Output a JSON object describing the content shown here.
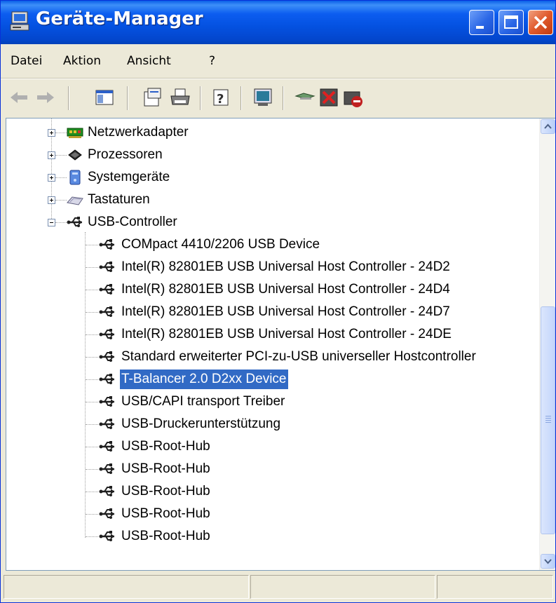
{
  "window": {
    "title": "Geräte-Manager",
    "icon": "device-manager-computer-icon",
    "controls": [
      "minimize-icon",
      "maximize-icon",
      "close-icon"
    ]
  },
  "menu": {
    "items": [
      {
        "label": "Datei"
      },
      {
        "label": "Aktion"
      },
      {
        "label": "Ansicht"
      },
      {
        "label": "?"
      }
    ]
  },
  "toolbar": {
    "buttons": [
      "back-arrow-icon",
      "forward-arrow-icon",
      "show-hide-console-tree-icon",
      "properties-icon",
      "print-icon",
      "help-icon",
      "computer-view-icon",
      "scan-hardware-icon",
      "uninstall-icon",
      "disable-device-icon"
    ]
  },
  "tree": {
    "categories": [
      {
        "label": "Netzwerkadapter",
        "icon": "network-card-icon",
        "expanded": false
      },
      {
        "label": "Prozessoren",
        "icon": "processor-icon",
        "expanded": false
      },
      {
        "label": "Systemgeräte",
        "icon": "system-devices-icon",
        "expanded": false
      },
      {
        "label": "Tastaturen",
        "icon": "keyboard-icon",
        "expanded": false
      },
      {
        "label": "USB-Controller",
        "icon": "usb-icon",
        "expanded": true
      }
    ],
    "usb_devices": [
      {
        "label": "COMpact 4410/2206 USB Device"
      },
      {
        "label": "Intel(R) 82801EB USB Universal Host Controller - 24D2"
      },
      {
        "label": "Intel(R) 82801EB USB Universal Host Controller - 24D4"
      },
      {
        "label": "Intel(R) 82801EB USB Universal Host Controller - 24D7"
      },
      {
        "label": "Intel(R) 82801EB USB Universal Host Controller - 24DE"
      },
      {
        "label": "Standard erweiterter PCI-zu-USB universeller Hostcontroller"
      },
      {
        "label": "T-Balancer 2.0 D2xx Device",
        "selected": true
      },
      {
        "label": "USB/CAPI transport Treiber"
      },
      {
        "label": "USB-Druckerunterstützung"
      },
      {
        "label": "USB-Root-Hub"
      },
      {
        "label": "USB-Root-Hub"
      },
      {
        "label": "USB-Root-Hub"
      },
      {
        "label": "USB-Root-Hub"
      },
      {
        "label": "USB-Root-Hub"
      }
    ]
  },
  "colors": {
    "titlebar": "#0451e0",
    "selection": "#316ac5",
    "window_bg": "#ece9d8"
  }
}
